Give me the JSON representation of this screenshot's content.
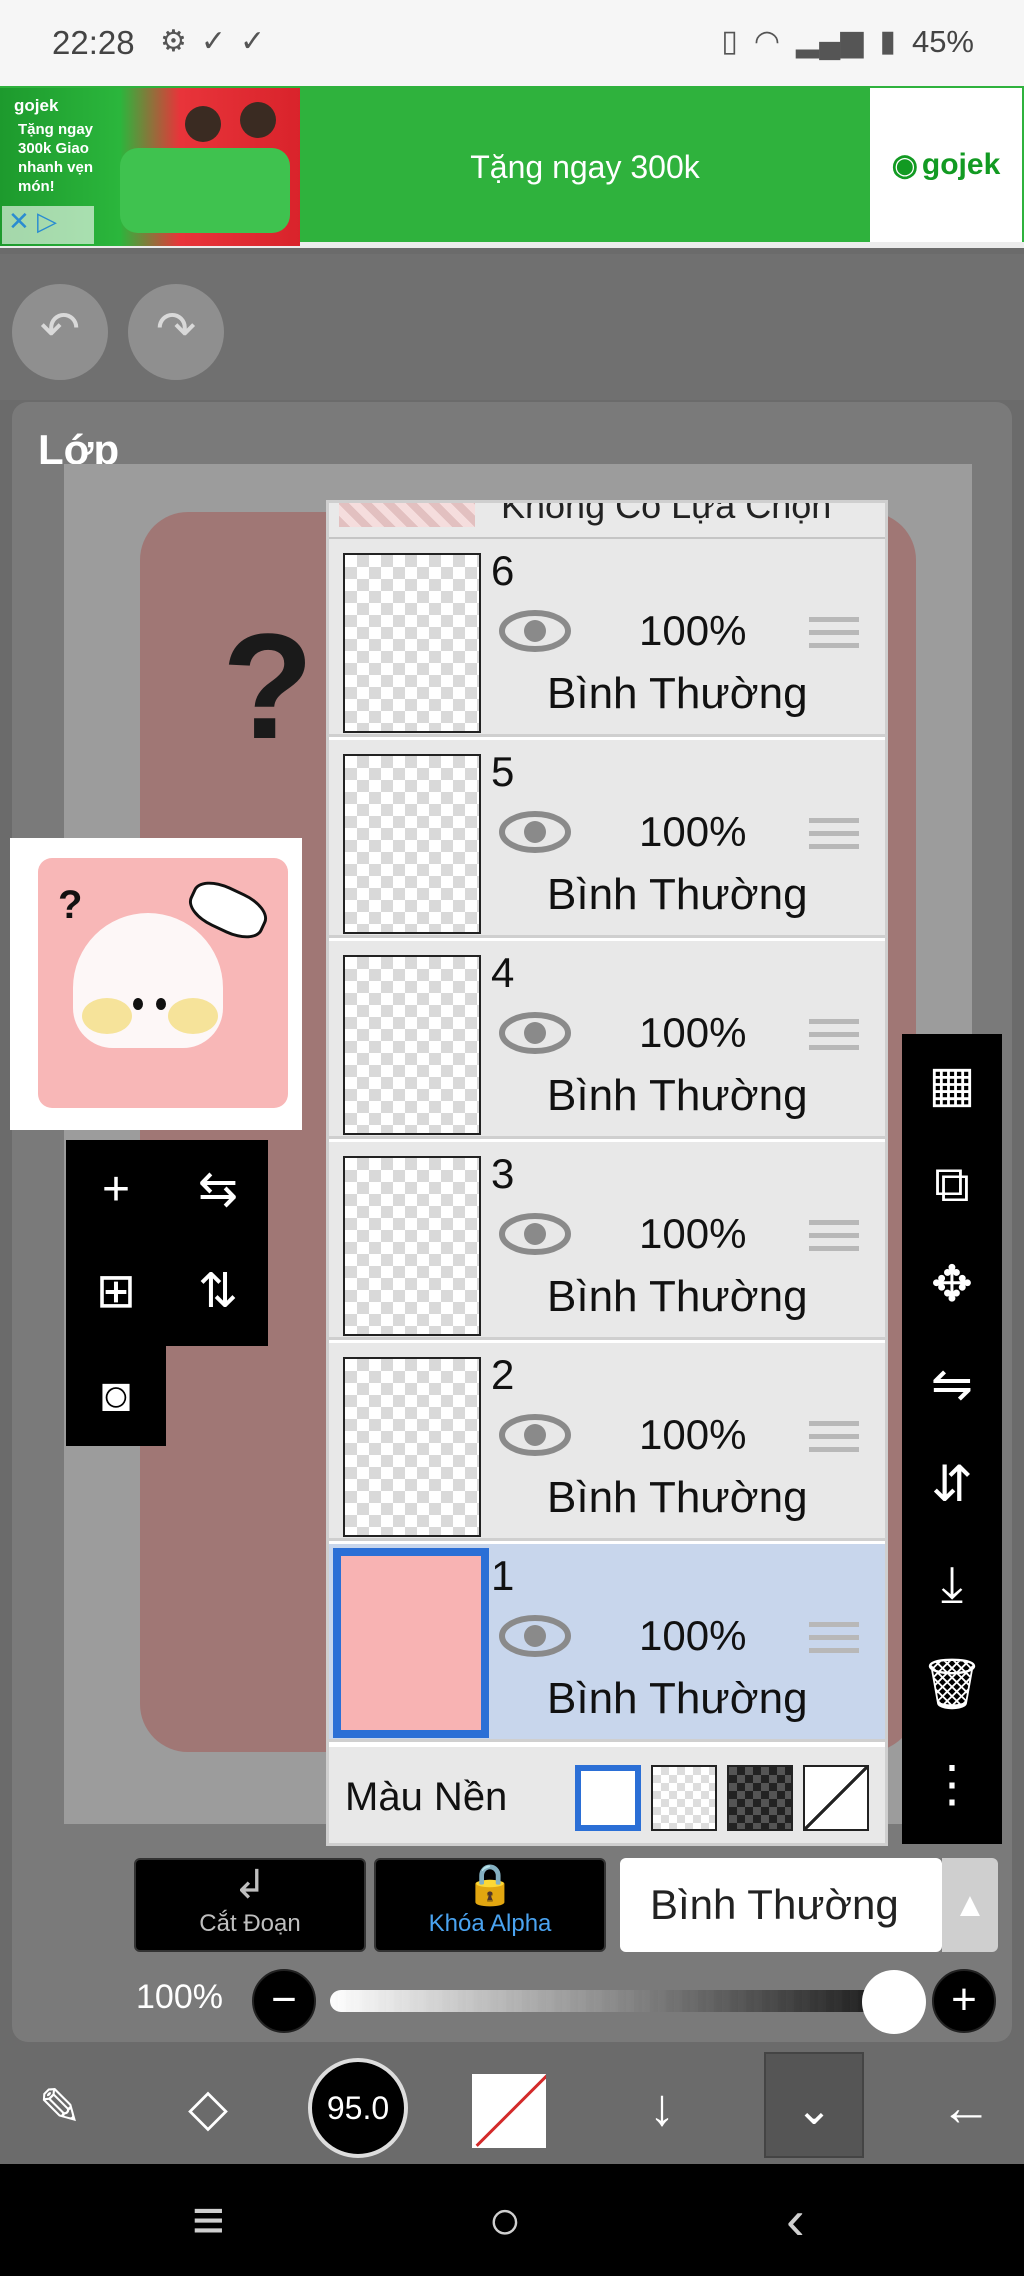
{
  "status": {
    "time": "22:28",
    "battery": "45%",
    "left_icons": [
      "gear-icon",
      "checkmark-icon",
      "checkmark-icon"
    ],
    "right_icons": [
      "vibrate-icon",
      "wifi-icon",
      "signal-icon",
      "battery-icon"
    ]
  },
  "ad": {
    "brand": "gojek",
    "image_text": "Tặng ngay 300k Giao nhanh vẹn món!",
    "headline": "Tặng ngay 300k",
    "logo_text": "gojek"
  },
  "panel": {
    "title": "Lớp",
    "partial_row_text": "Không Có Lựa Chọn"
  },
  "layers": [
    {
      "number": "6",
      "opacity": "100%",
      "blend": "Bình Thường",
      "selected": false
    },
    {
      "number": "5",
      "opacity": "100%",
      "blend": "Bình Thường",
      "selected": false
    },
    {
      "number": "4",
      "opacity": "100%",
      "blend": "Bình Thường",
      "selected": false
    },
    {
      "number": "3",
      "opacity": "100%",
      "blend": "Bình Thường",
      "selected": false
    },
    {
      "number": "2",
      "opacity": "100%",
      "blend": "Bình Thường",
      "selected": false
    },
    {
      "number": "1",
      "opacity": "100%",
      "blend": "Bình Thường",
      "selected": true
    }
  ],
  "background": {
    "label": "Màu Nền",
    "swatches": [
      "white",
      "transparent",
      "dark-checker",
      "none"
    ]
  },
  "bottom": {
    "clip_label": "Cắt Đoạn",
    "alpha_lock_label": "Khóa Alpha",
    "blend_mode": "Bình Thường",
    "opacity_label": "100%",
    "opacity_value": 1.0
  },
  "toolbar": {
    "brush_size": "95.0"
  },
  "colors": {
    "accent": "#2b6fd6",
    "alpha_lock": "#4aa3f0",
    "ad_green": "#2fb23d",
    "canvas_pink": "#f8b3b3"
  }
}
